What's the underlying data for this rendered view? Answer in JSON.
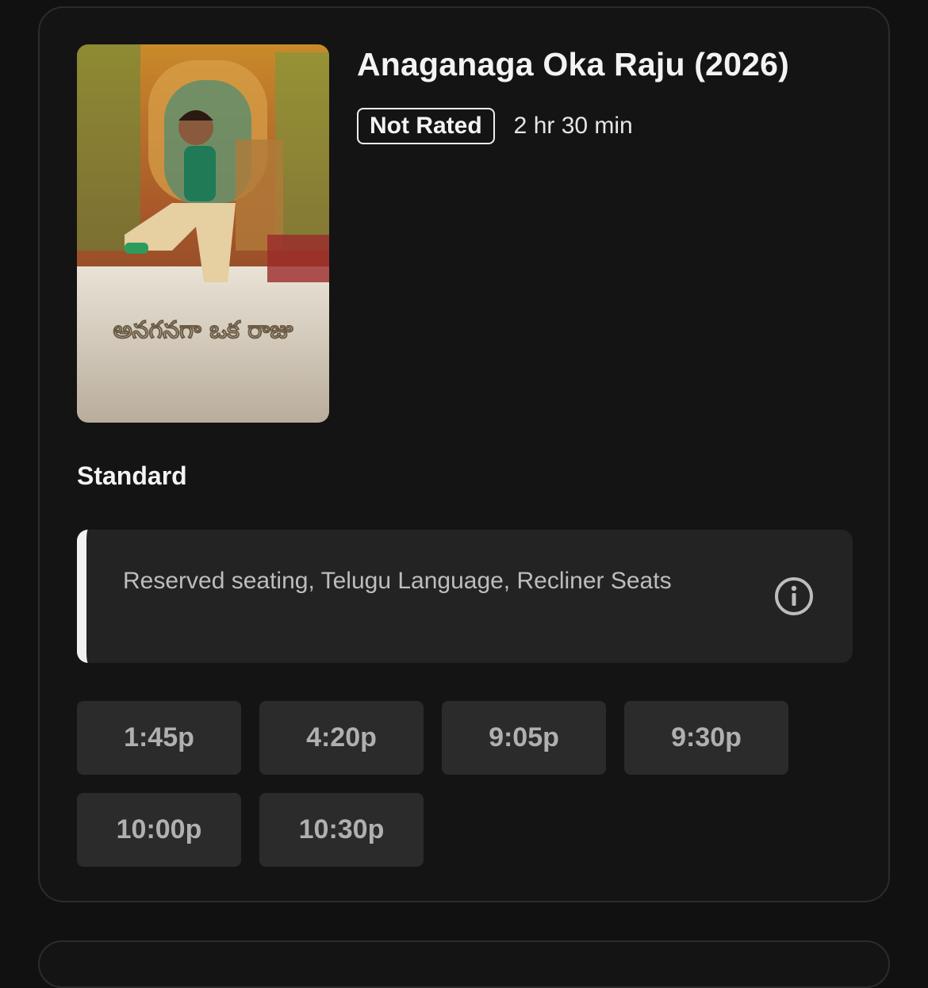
{
  "movie": {
    "title": "Anaganaga Oka Raju (2026)",
    "rating": "Not Rated",
    "runtime": "2 hr 30 min",
    "poster_logo_text": "అనగనగా ఒక రాజు"
  },
  "format": {
    "label": "Standard",
    "amenities": "Reserved seating, Telugu Language, Recliner Seats",
    "info_icon": "info-circle-icon"
  },
  "showtimes": [
    "1:45p",
    "4:20p",
    "9:05p",
    "9:30p",
    "10:00p",
    "10:30p"
  ],
  "colors": {
    "background": "#111111",
    "card": "#141414",
    "card_border": "#2c2c2c",
    "panel": "#232323",
    "accent_bar": "#f1f1f1",
    "time_button": "#2b2b2b",
    "time_text": "#b0b0b0"
  }
}
